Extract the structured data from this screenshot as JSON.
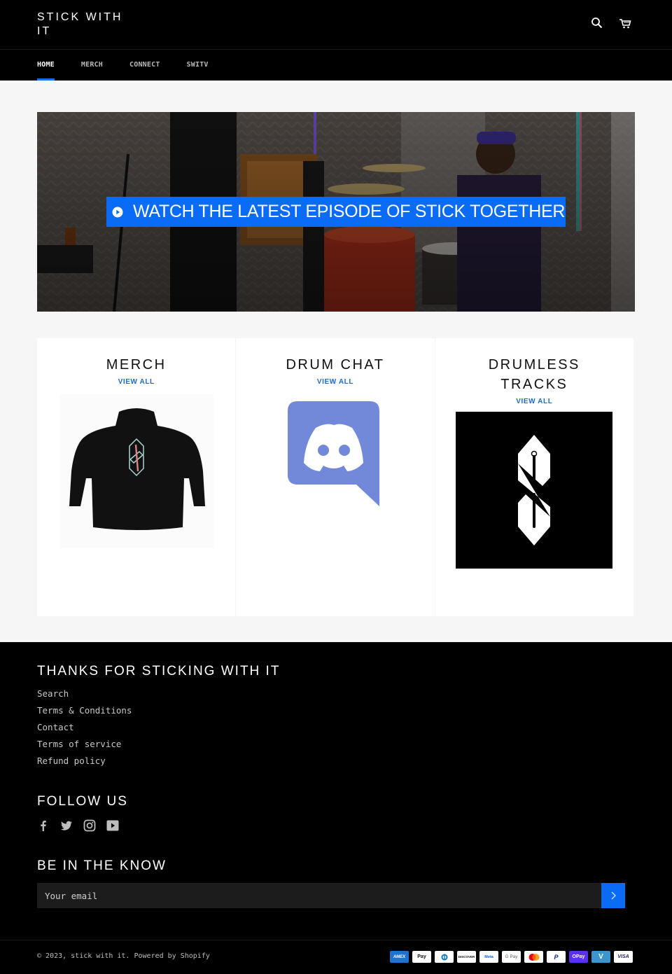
{
  "header": {
    "logo": "STICK WITH IT",
    "icons": [
      "search-icon",
      "cart-icon"
    ]
  },
  "nav": {
    "items": [
      {
        "label": "HOME",
        "active": true
      },
      {
        "label": "MERCH",
        "active": false
      },
      {
        "label": "CONNECT",
        "active": false
      },
      {
        "label": "SWITV",
        "active": false
      }
    ]
  },
  "hero": {
    "cta_label": "WATCH THE LATEST EPISODE OF STICK TOGETHER",
    "cta_icon": "play-circle-icon",
    "cta_color": "#0a6cf5"
  },
  "collections": [
    {
      "title": "MERCH",
      "link": "VIEW ALL",
      "image": "black-hoodie-s-logo"
    },
    {
      "title": "DRUM CHAT",
      "link": "VIEW ALL",
      "image": "discord-logo"
    },
    {
      "title": "DRUMLESS TRACKS",
      "link": "VIEW ALL",
      "image": "s-drumstick-logo"
    }
  ],
  "footer": {
    "links_heading": "THANKS FOR STICKING WITH IT",
    "links": [
      "Search",
      "Terms & Conditions",
      "Contact",
      "Terms of service",
      "Refund policy"
    ],
    "follow_heading": "FOLLOW US",
    "social": [
      "facebook-icon",
      "twitter-icon",
      "instagram-icon",
      "youtube-icon"
    ],
    "newsletter_heading": "BE IN THE KNOW",
    "email_placeholder": "Your email",
    "subscribe_icon": "chevron-right-icon",
    "copyright_prefix": "© 2023, stick with it. ",
    "powered_by": "Powered by Shopify",
    "payment_methods": [
      "American Express",
      "Apple Pay",
      "Diners Club",
      "Discover",
      "Meta Pay",
      "Google Pay",
      "Mastercard",
      "PayPal",
      "Shop Pay",
      "Venmo",
      "Visa"
    ],
    "payment_labels": [
      "AMEX",
      "Pay",
      "DC",
      "DISCOVER",
      "Meta",
      "G Pay",
      "",
      "P",
      "OPay",
      "V",
      "VISA"
    ]
  },
  "colors": {
    "accent": "#0a6cf5",
    "link": "#1d6cc8",
    "discord": "#7289da"
  }
}
